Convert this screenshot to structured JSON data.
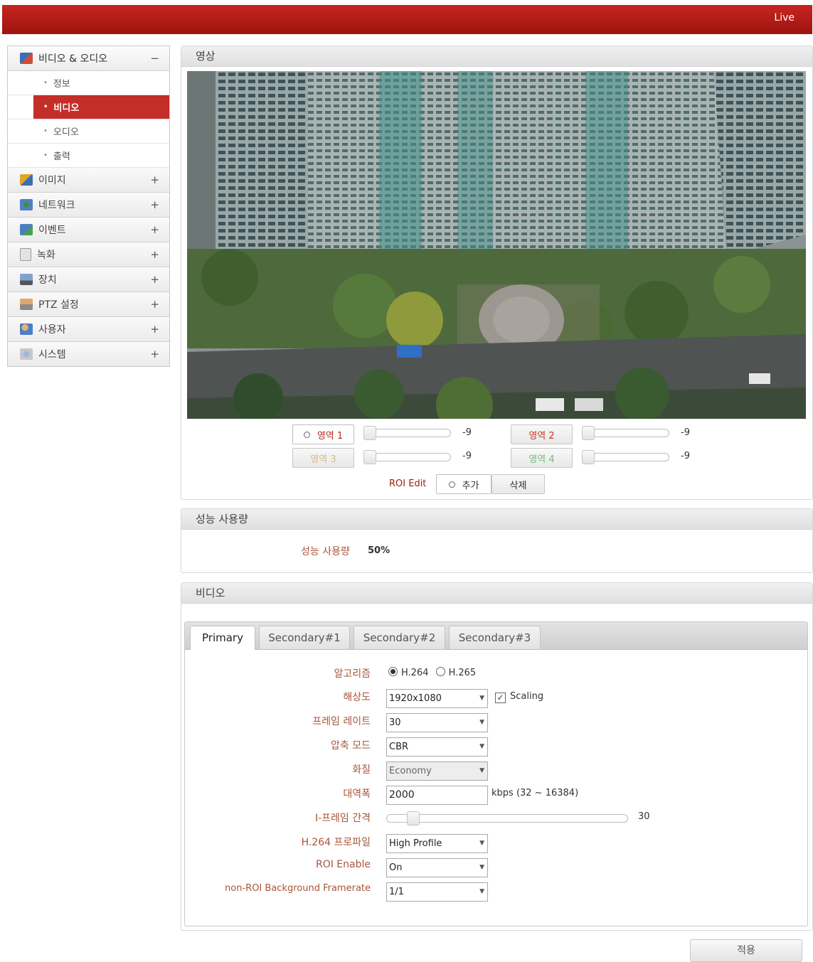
{
  "header": {
    "live_label": "Live"
  },
  "sidebar": {
    "section": {
      "label": "비디오 & 오디오",
      "sign": "−"
    },
    "sub_items": [
      {
        "label": "정보"
      },
      {
        "label": "비디오"
      },
      {
        "label": "오디오"
      },
      {
        "label": "출력"
      }
    ],
    "items": [
      {
        "label": "이미지",
        "sign": "+"
      },
      {
        "label": "네트워크",
        "sign": "+"
      },
      {
        "label": "이벤트",
        "sign": "+"
      },
      {
        "label": "녹화",
        "sign": "+"
      },
      {
        "label": "장치",
        "sign": "+"
      },
      {
        "label": "PTZ 설정",
        "sign": "+"
      },
      {
        "label": "사용자",
        "sign": "+"
      },
      {
        "label": "시스템",
        "sign": "+"
      }
    ]
  },
  "video_panel": {
    "title": "영상",
    "roi_areas": [
      {
        "label": "영역 1",
        "value": "-9",
        "color": "#b52a22"
      },
      {
        "label": "영역 2",
        "value": "-9",
        "color": "#c0392b"
      },
      {
        "label": "영역 3",
        "value": "-9",
        "color": "#d6b98a"
      },
      {
        "label": "영역 4",
        "value": "-9",
        "color": "#6fbf7a"
      }
    ],
    "roi_edit": {
      "label": "ROI Edit",
      "add": "추가",
      "delete": "삭제"
    }
  },
  "performance": {
    "title": "성능 사용량",
    "label": "성능 사용량",
    "value": "50%"
  },
  "video_settings": {
    "title": "비디오",
    "tabs": [
      "Primary",
      "Secondary#1",
      "Secondary#2",
      "Secondary#3"
    ],
    "algorithm": {
      "label": "알고리즘",
      "options": [
        "H.264",
        "H.265"
      ]
    },
    "resolution": {
      "label": "해상도",
      "value": "1920x1080",
      "scaling": "Scaling"
    },
    "framerate": {
      "label": "프레임 레이트",
      "value": "30"
    },
    "compression": {
      "label": "압축 모드",
      "value": "CBR"
    },
    "quality": {
      "label": "화질",
      "value": "Economy"
    },
    "bandwidth": {
      "label": "대역폭",
      "value": "2000",
      "unit": "kbps (32 ~ 16384)"
    },
    "iframe": {
      "label": "I-프레임 간격",
      "value": "30"
    },
    "profile": {
      "label": "H.264 프로파일",
      "value": "High Profile"
    },
    "roi_enable": {
      "label": "ROI Enable",
      "value": "On"
    },
    "nonroi_fps": {
      "label": "non-ROI Background Framerate",
      "value": "1/1"
    }
  },
  "apply_label": "적용"
}
